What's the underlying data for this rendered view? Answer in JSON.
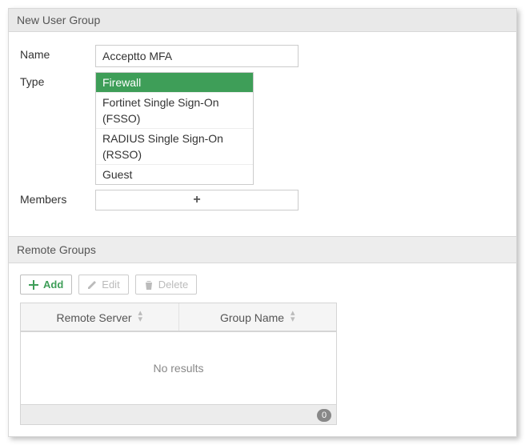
{
  "header": {
    "title": "New User Group"
  },
  "form": {
    "name_label": "Name",
    "name_value": "Acceptto MFA",
    "type_label": "Type",
    "type_options": [
      "Firewall",
      "Fortinet Single Sign-On (FSSO)",
      "RADIUS Single Sign-On (RSSO)",
      "Guest"
    ],
    "type_selected_index": 0,
    "members_label": "Members",
    "members_placeholder": "+"
  },
  "remote_groups": {
    "section_title": "Remote Groups",
    "toolbar": {
      "add_label": "Add",
      "edit_label": "Edit",
      "delete_label": "Delete"
    },
    "columns": [
      "Remote Server",
      "Group Name"
    ],
    "empty_text": "No results",
    "count": "0"
  }
}
